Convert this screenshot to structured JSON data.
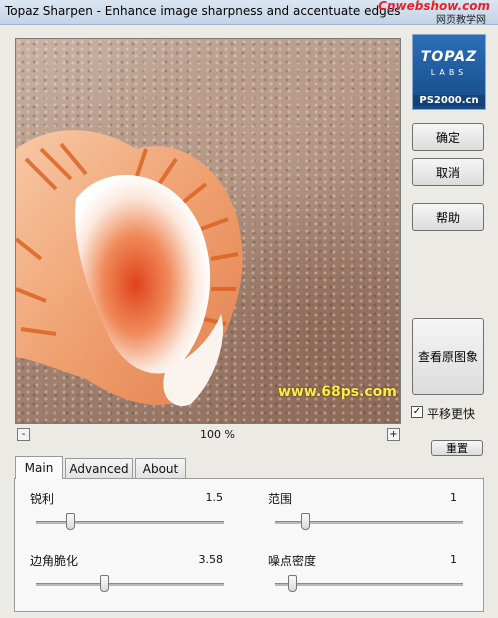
{
  "window": {
    "title": "Topaz Sharpen - Enhance image sharpness and accentuate edges"
  },
  "watermark": {
    "brand": "Cnwebshow.com",
    "cn": "网页教学网"
  },
  "preview": {
    "watermark": "www.68ps.com"
  },
  "logo": {
    "name": "TOPAZ",
    "sub": "LABS",
    "watermark": "PS2000.cn"
  },
  "buttons": {
    "ok": "确定",
    "cancel": "取消",
    "help": "帮助",
    "view_original": "查看原图象",
    "reset": "重置",
    "zoom_out": "-",
    "zoom_in": "+"
  },
  "zoom": {
    "label": "100 %"
  },
  "smooth_scroll": {
    "label": "平移更快",
    "checked": true
  },
  "tabs": [
    {
      "label": "Main",
      "active": true
    },
    {
      "label": "Advanced",
      "active": false
    },
    {
      "label": "About",
      "active": false
    }
  ],
  "sliders": {
    "sharpness": {
      "label": "锐利",
      "value": "1.5",
      "level": 0.18
    },
    "radius": {
      "label": "范围",
      "value": "1",
      "level": 0.16
    },
    "edge_crisp": {
      "label": "边角脆化",
      "value": "3.58",
      "level": 0.36
    },
    "noise_density": {
      "label": "噪点密度",
      "value": "1",
      "level": 0.09
    }
  }
}
